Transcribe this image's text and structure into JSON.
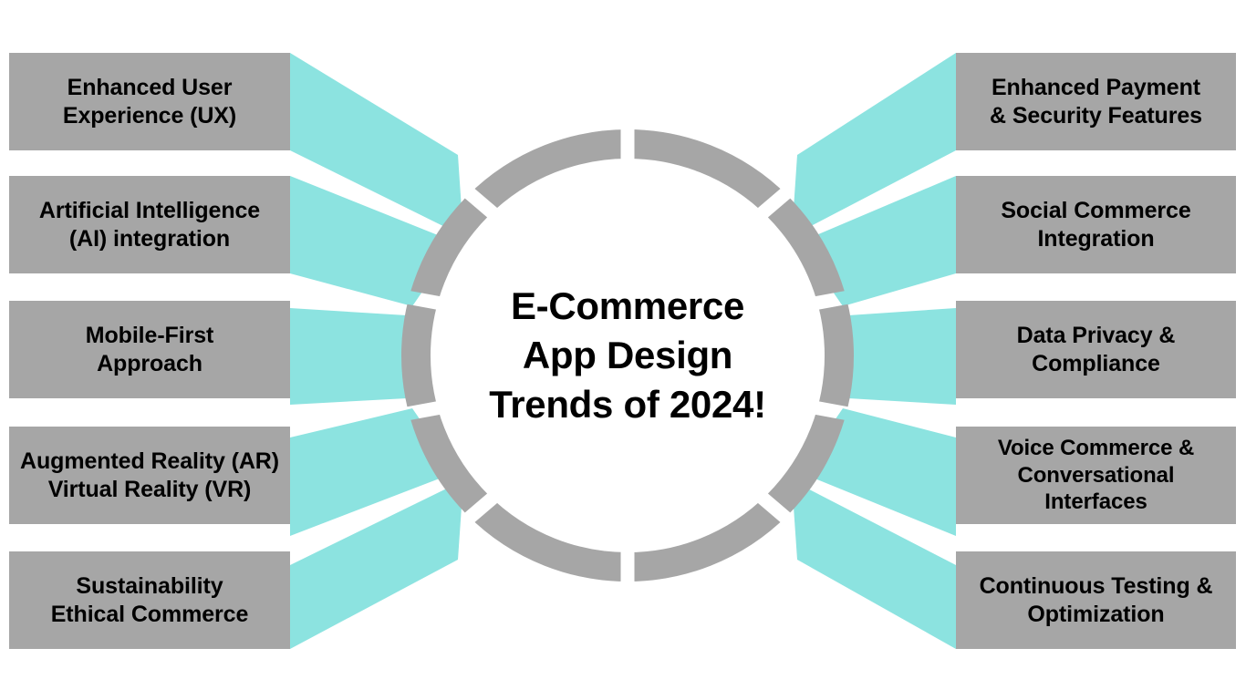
{
  "diagram": {
    "type": "hub-and-spoke-funnel",
    "center": {
      "title": "E-Commerce\nApp Design\nTrends of 2024!"
    },
    "colors": {
      "box_fill": "#a6a6a6",
      "connector_fill": "#8ce3e0",
      "ring_stroke": "#a6a6a6",
      "background": "#ffffff",
      "text": "#000000"
    },
    "left_items": [
      {
        "label": "Enhanced User\nExperience (UX)"
      },
      {
        "label": "Artificial Intelligence\n(AI) integration"
      },
      {
        "label": "Mobile-First\nApproach"
      },
      {
        "label": "Augmented Reality (AR)\nVirtual Reality (VR)"
      },
      {
        "label": "Sustainability\nEthical Commerce"
      }
    ],
    "right_items": [
      {
        "label": "Enhanced Payment\n&  Security Features"
      },
      {
        "label": "Social Commerce\nIntegration"
      },
      {
        "label": "Data Privacy &\nCompliance"
      },
      {
        "label": "Voice Commerce &\nConversational\nInterfaces"
      },
      {
        "label": "Continuous Testing &\nOptimization"
      }
    ]
  }
}
